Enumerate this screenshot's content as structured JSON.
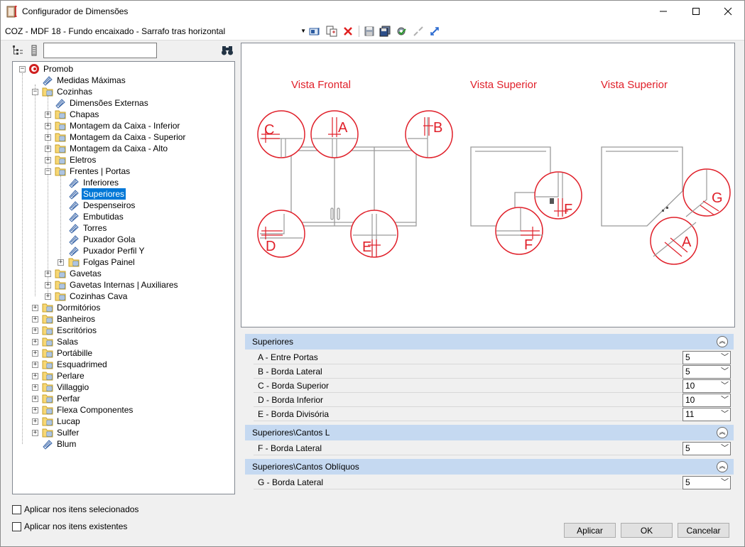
{
  "window": {
    "title": "Configurador de Dimensões"
  },
  "toolbar": {
    "config_value": "COZ - MDF 18 - Fundo encaixado - Sarrafo tras horizontal"
  },
  "search": {
    "value": ""
  },
  "tree": {
    "root": "Promob",
    "medidas": "Medidas Máximas",
    "cozinhas": "Cozinhas",
    "dim_externas": "Dimensões Externas",
    "chapas": "Chapas",
    "mont_inferior": "Montagem da Caixa - Inferior",
    "mont_superior": "Montagem da Caixa - Superior",
    "mont_alto": "Montagem da Caixa - Alto",
    "eletros": "Eletros",
    "frentes": "Frentes | Portas",
    "inferiores": "Inferiores",
    "superiores": "Superiores",
    "despenseiros": "Despenseiros",
    "embutidas": "Embutidas",
    "torres": "Torres",
    "puxador_gola": "Puxador Gola",
    "puxador_perfil": "Puxador Perfil Y",
    "folgas": "Folgas Painel",
    "gavetas": "Gavetas",
    "gavetas_internas": "Gavetas Internas | Auxiliares",
    "cozinhas_cava": "Cozinhas Cava",
    "dormitorios": "Dormitórios",
    "banheiros": "Banheiros",
    "escritorios": "Escritórios",
    "salas": "Salas",
    "portabille": "Portábille",
    "esquadrimed": "Esquadrimed",
    "perlare": "Perlare",
    "villaggio": "Villaggio",
    "perfar": "Perfar",
    "flexa": "Flexa Componentes",
    "lucap": "Lucap",
    "sulfer": "Sulfer",
    "blum": "Blum"
  },
  "preview": {
    "vista_frontal": "Vista Frontal",
    "vista_superior_1": "Vista Superior",
    "vista_superior_2": "Vista Superior",
    "labels": {
      "a": "A",
      "b": "B",
      "c": "C",
      "d": "D",
      "e": "E",
      "f": "F",
      "g": "G"
    },
    "accent_color": "#e0202a"
  },
  "sections": [
    {
      "title": "Superiores",
      "rows": [
        {
          "name": "A - Entre Portas",
          "value": "5"
        },
        {
          "name": "B - Borda Lateral",
          "value": "5"
        },
        {
          "name": "C - Borda Superior",
          "value": "10"
        },
        {
          "name": "D - Borda Inferior",
          "value": "10"
        },
        {
          "name": "E - Borda Divisória",
          "value": "11"
        }
      ]
    },
    {
      "title": "Superiores\\Cantos L",
      "rows": [
        {
          "name": "F - Borda Lateral",
          "value": "5"
        }
      ]
    },
    {
      "title": "Superiores\\Cantos Oblíquos",
      "rows": [
        {
          "name": "G - Borda Lateral",
          "value": "5"
        }
      ]
    }
  ],
  "options": {
    "apply_selected": "Aplicar nos itens selecionados",
    "apply_existing": "Aplicar nos itens existentes"
  },
  "buttons": {
    "apply": "Aplicar",
    "ok": "OK",
    "cancel": "Cancelar"
  }
}
